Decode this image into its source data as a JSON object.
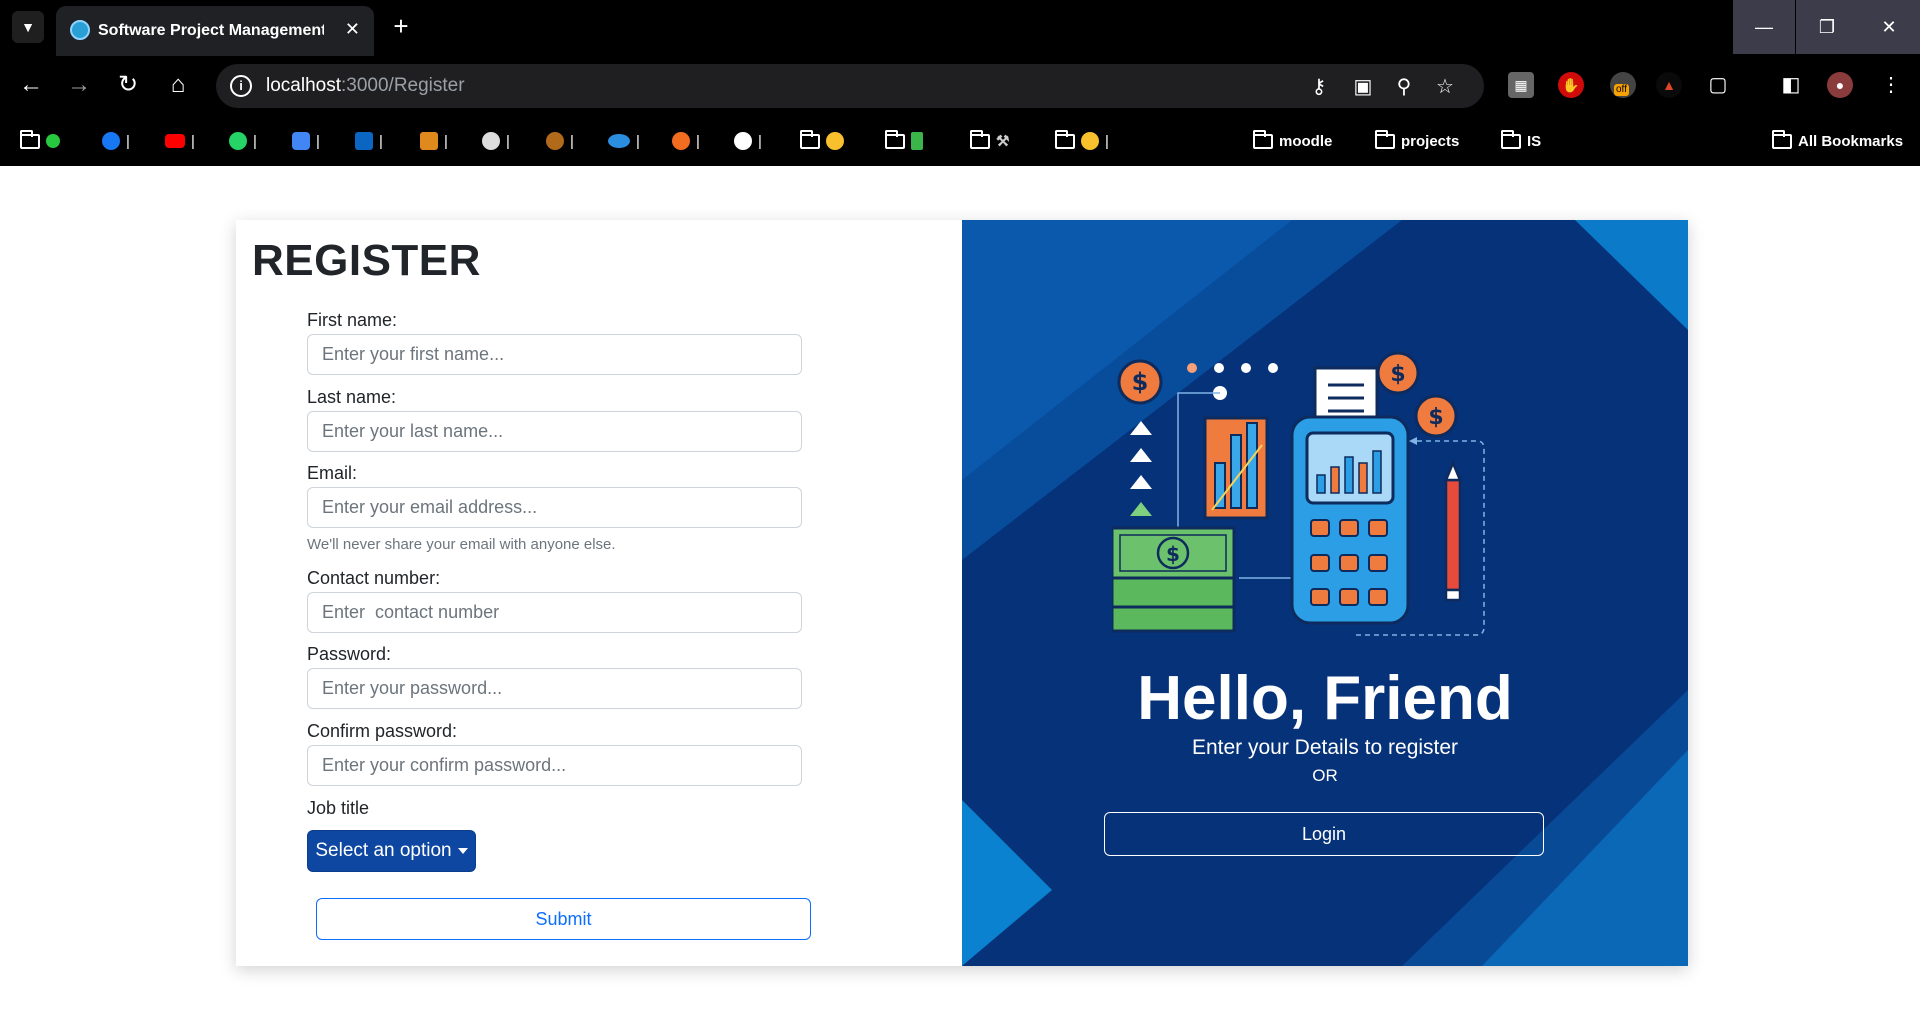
{
  "browser": {
    "tab_title": "Software Project Management Sy",
    "url_host": "localhost",
    "url_path": ":3000/Register",
    "bookmarks": [
      "moodle",
      "projects",
      "IS"
    ],
    "all_bookmarks_label": "All Bookmarks",
    "extension_badge": "off"
  },
  "form": {
    "title": "REGISTER",
    "first_name_label": "First name:",
    "first_name_placeholder": "Enter your first name...",
    "last_name_label": "Last name:",
    "last_name_placeholder": "Enter your last name...",
    "email_label": "Email:",
    "email_placeholder": "Enter your email address...",
    "email_help": "We'll never share your email with anyone else.",
    "contact_label": "Contact number:",
    "contact_placeholder": "Enter  contact number",
    "password_label": "Password:",
    "password_placeholder": "Enter your password...",
    "confirm_label": "Confirm password:",
    "confirm_placeholder": "Enter your confirm password...",
    "job_label": "Job title",
    "job_dropdown_label": "Select an option",
    "submit_label": "Submit"
  },
  "promo": {
    "heading": "Hello, Friend",
    "subtitle": "Enter your Details to register",
    "or": "OR",
    "login_label": "Login"
  },
  "colors": {
    "promo_bg": "#06327a",
    "accent_blue": "#0d6efd",
    "dropdown_blue": "#0d47a1"
  }
}
